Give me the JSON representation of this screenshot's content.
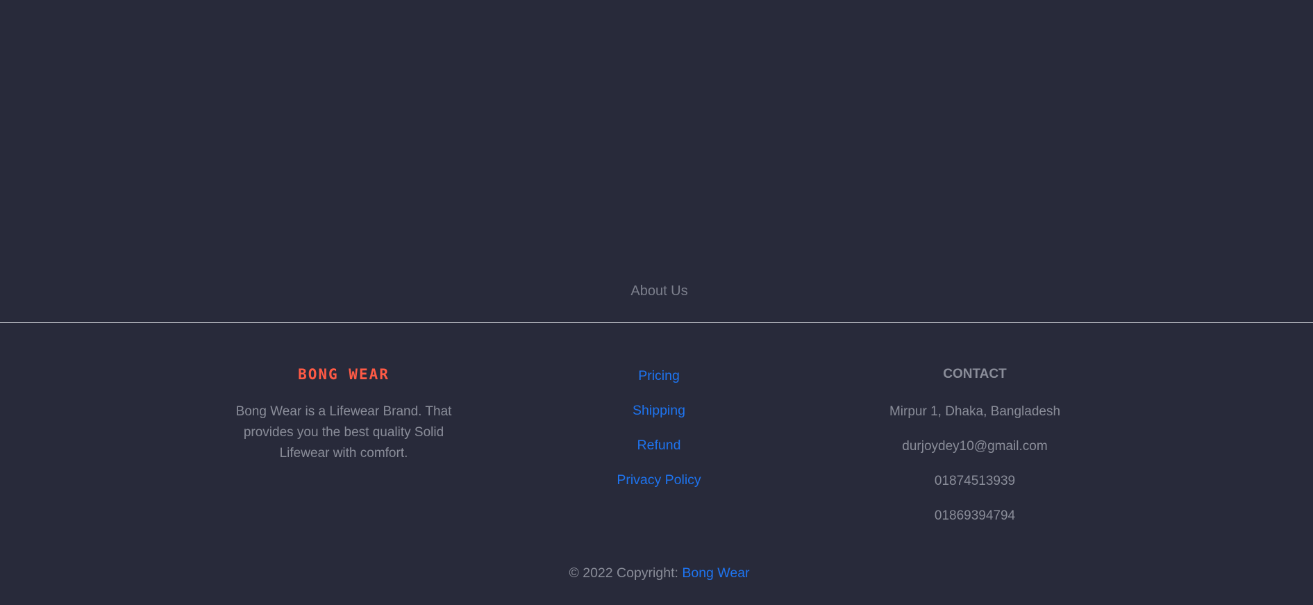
{
  "footer": {
    "about_link": "About Us",
    "brand": {
      "logo_text": "BONG WEAR",
      "description": "Bong Wear is a Lifewear Brand. That provides you the best quality Solid Lifewear with comfort."
    },
    "links": [
      {
        "label": "Pricing"
      },
      {
        "label": "Shipping"
      },
      {
        "label": "Refund"
      },
      {
        "label": "Privacy Policy"
      }
    ],
    "contact": {
      "title": "CONTACT",
      "address": "Mirpur 1, Dhaka, Bangladesh",
      "email": "durjoydey10@gmail.com",
      "phone_1": "01874513939",
      "phone_2": "01869394794"
    },
    "copyright": {
      "prefix": "© 2022 Copyright:",
      "brand_link": "Bong Wear"
    }
  },
  "colors": {
    "background": "#282a3a",
    "logo": "#ff5a45",
    "link": "#1e74f0",
    "muted_text": "#8a8d99",
    "divider": "#bfc1c9"
  }
}
